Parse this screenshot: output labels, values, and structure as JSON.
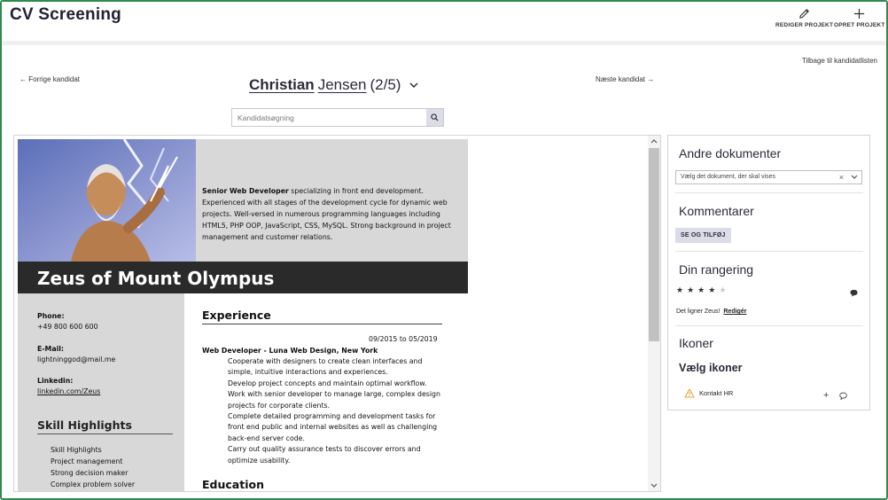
{
  "app": {
    "title": "CV Screening"
  },
  "toolbar": {
    "edit_label": "REDIGER PROJEKT",
    "create_label": "OPRET PROJEKT"
  },
  "nav": {
    "back_to_list": "Tilbage til kandidatlisten",
    "prev": "← Forrige kandidat",
    "next": "Næste kandidat →"
  },
  "candidate": {
    "first_name": "Christian",
    "last_name": "Jensen",
    "position": "(2/5)"
  },
  "search": {
    "placeholder": "Kandidatsøgning"
  },
  "cv": {
    "summary_bold": "Senior Web Developer",
    "summary_text": " specializing in front end development. Experienced with all stages of the development cycle for dynamic web projects. Well-versed in numerous programming languages including HTML5, PHP OOP, JavaScript, CSS, MySQL. Strong background in project management and customer relations.",
    "name": "Zeus of Mount Olympus",
    "phone_label": "Phone:",
    "phone": "+49 800 600 600",
    "email_label": "E-Mail:",
    "email": "lightninggod@mail.me",
    "linkedin_label": "Linkedin:",
    "linkedin": "linkedin.com/Zeus",
    "skills_heading": "Skill Highlights",
    "skills": [
      "Skill Highlights",
      "Project management",
      "Strong decision maker",
      "Complex problem solver"
    ],
    "experience_heading": "Experience",
    "job_dates": "09/2015 to 05/2019",
    "job_title": "Web Developer -  Luna Web Design, New York",
    "duties": [
      "Cooperate with designers to create clean interfaces and simple, intuitive interactions and experiences.",
      "Develop project concepts and maintain optimal workflow.",
      "Work with senior developer to manage large, complex design projects for corporate clients.",
      "Complete detailed programming and development tasks for front end public and internal websites as well as challenging back-end server code.",
      "Carry out quality assurance tests to discover errors and optimize usability."
    ],
    "education_heading": "Education"
  },
  "panel": {
    "documents_heading": "Andre dokumenter",
    "documents_select": "Vælg det dokument, der skal vises",
    "comments_heading": "Kommentarer",
    "comments_button": "SE OG TILFØJ",
    "rating_heading": "Din rangering",
    "rating": 4,
    "rating_max": 5,
    "rating_note": "Det ligner Zeus!",
    "rating_edit": "Redigér",
    "icons_heading": "Ikoner",
    "icons_sub": "Vælg ikoner",
    "icon_item": "Kontakt HR"
  },
  "colors": {
    "frame": "#2f8a4e",
    "accent_button": "#dcdce8",
    "warning": "#e8a33a"
  }
}
